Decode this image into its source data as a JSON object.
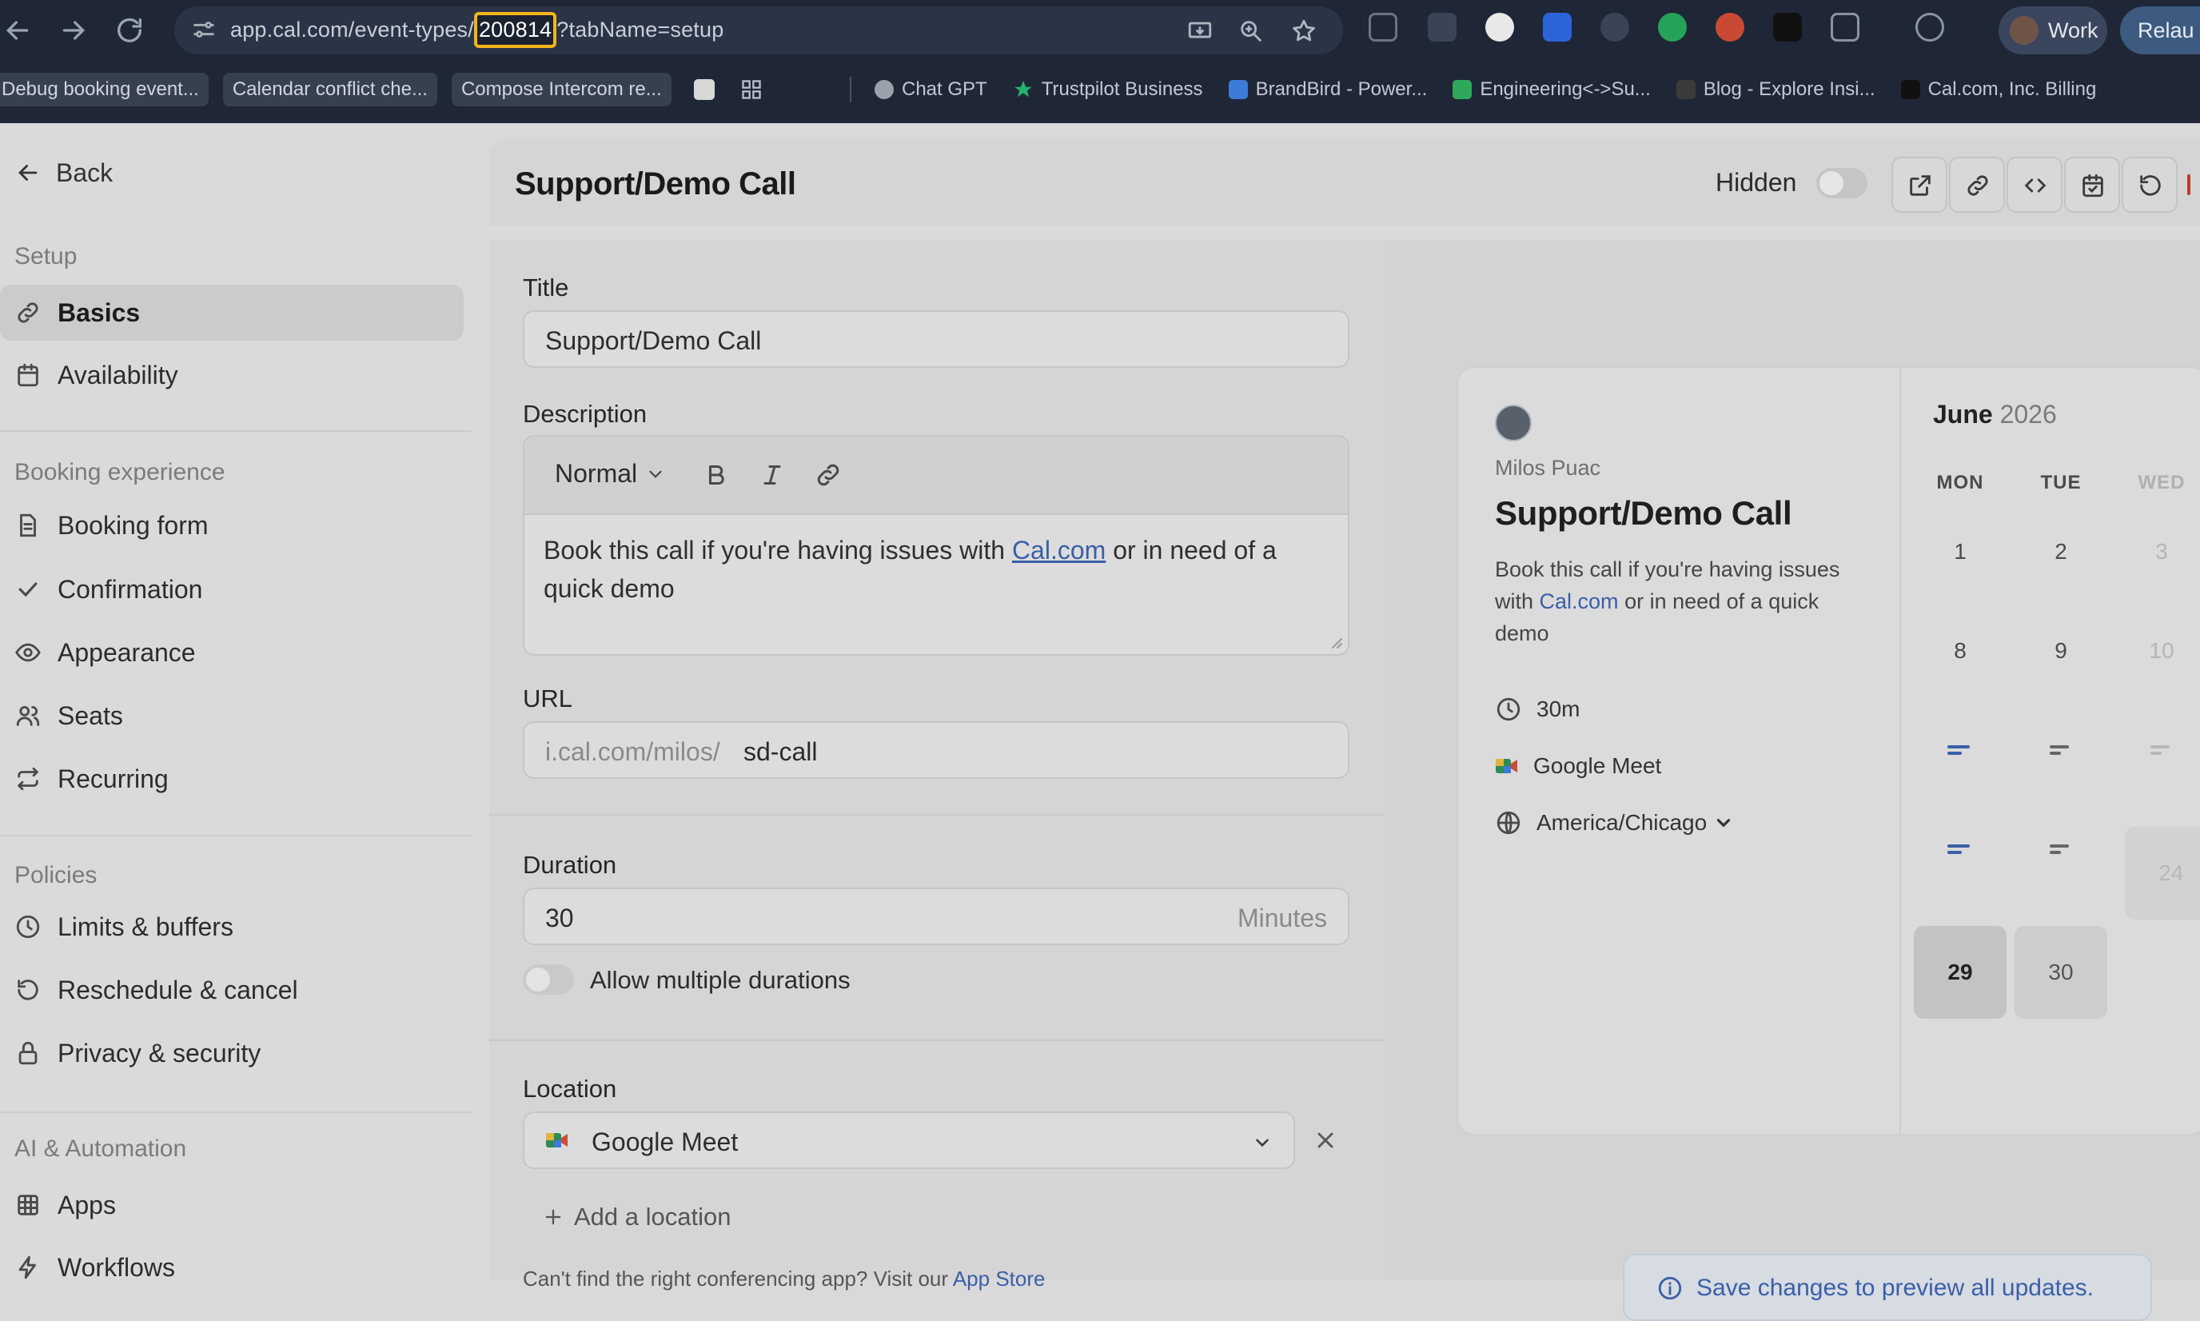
{
  "browser": {
    "url_prefix": "app.cal.com/event-types/",
    "url_highlight": "200814",
    "url_suffix": "?tabName=setup",
    "profile_label": "Work",
    "relaunch_label": "Relau",
    "bookmarks": [
      "Debug booking event...",
      "Calendar conflict che...",
      "Compose Intercom re...",
      "Chat GPT",
      "Trustpilot Business",
      "BrandBird - Power...",
      "Engineering<->Su...",
      "Blog - Explore Insi...",
      "Cal.com, Inc. Billing"
    ]
  },
  "sidebar": {
    "back_label": "Back",
    "sections": [
      {
        "heading": "Setup",
        "items": [
          {
            "label": "Basics",
            "icon": "link-icon",
            "active": true
          },
          {
            "label": "Availability",
            "icon": "calendar-icon"
          }
        ]
      },
      {
        "heading": "Booking experience",
        "items": [
          {
            "label": "Booking form",
            "icon": "file-icon"
          },
          {
            "label": "Confirmation",
            "icon": "check-icon"
          },
          {
            "label": "Appearance",
            "icon": "eye-icon"
          },
          {
            "label": "Seats",
            "icon": "users-icon"
          },
          {
            "label": "Recurring",
            "icon": "repeat-icon"
          }
        ]
      },
      {
        "heading": "Policies",
        "items": [
          {
            "label": "Limits & buffers",
            "icon": "clock-icon"
          },
          {
            "label": "Reschedule & cancel",
            "icon": "rotate-ccw-icon"
          },
          {
            "label": "Privacy & security",
            "icon": "lock-icon"
          }
        ]
      },
      {
        "heading": "AI & Automation",
        "items": [
          {
            "label": "Apps",
            "icon": "grid-icon"
          },
          {
            "label": "Workflows",
            "icon": "zap-icon"
          }
        ]
      }
    ]
  },
  "header": {
    "title": "Support/Demo Call",
    "hidden_label": "Hidden",
    "hidden_toggle_on": false,
    "actions": [
      "external-link-icon",
      "link-icon",
      "code-icon",
      "calendar-check-icon",
      "rotate-ccw-icon"
    ]
  },
  "form": {
    "title_label": "Title",
    "title_value": "Support/Demo Call",
    "description_label": "Description",
    "format_label": "Normal",
    "description_before": "Book this call if you're having issues with ",
    "description_link": "Cal.com",
    "description_after": " or in need of a quick demo",
    "url_label": "URL",
    "url_prefix": "i.cal.com/milos/",
    "url_slug": "sd-call",
    "duration_label": "Duration",
    "duration_value": "30",
    "duration_unit": "Minutes",
    "multiple_durations_label": "Allow multiple durations",
    "location_label": "Location",
    "location_value": "Google Meet",
    "add_location_label": "Add a location",
    "footer_text": "Can't find the right conferencing app? Visit our ",
    "footer_link": "App Store"
  },
  "preview": {
    "host_name": "Milos Puac",
    "title": "Support/Demo Call",
    "desc_before": "Book this call if you're having issues with ",
    "desc_link": "Cal.com",
    "desc_after": " or in need of a quick demo",
    "duration": "30m",
    "location": "Google Meet",
    "timezone": "America/Chicago",
    "month": "June",
    "year": "2026",
    "weekdays": [
      "MON",
      "TUE",
      "WED"
    ],
    "dates": [
      "1",
      "2",
      "3",
      "8",
      "9",
      "10",
      "24",
      "29",
      "30"
    ],
    "save_banner": "Save changes to preview all updates."
  },
  "colors": {
    "accent_link": "#3a5fa8",
    "highlight_border": "#f2b51a",
    "chrome_bg": "#1f2737"
  }
}
